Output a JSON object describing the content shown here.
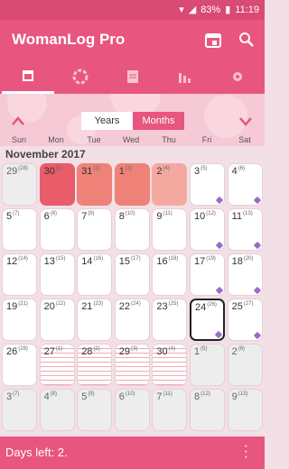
{
  "status": {
    "battery": "83%",
    "time": "11:19"
  },
  "app": {
    "title": "WomanLog Pro"
  },
  "view": {
    "years": "Years",
    "months": "Months"
  },
  "days_of_week": [
    "Sun",
    "Mon",
    "Tue",
    "Wed",
    "Thu",
    "Fri",
    "Sat"
  ],
  "month_title": "November 2017",
  "footer": {
    "days_left": "Days left: 2."
  },
  "calendar": [
    {
      "d": "29",
      "s": "(28)",
      "st": "gray"
    },
    {
      "d": "30",
      "s": "(1)",
      "st": "dark"
    },
    {
      "d": "31",
      "s": "(2)",
      "st": "mid"
    },
    {
      "d": "1",
      "s": "(3)",
      "st": "mid"
    },
    {
      "d": "2",
      "s": "(4)",
      "st": "light"
    },
    {
      "d": "3",
      "s": "(5)",
      "st": "white"
    },
    {
      "d": "4",
      "s": "(6)",
      "st": "white"
    },
    {
      "d": "5",
      "s": "(7)",
      "st": "white"
    },
    {
      "d": "6",
      "s": "(8)",
      "st": "white"
    },
    {
      "d": "7",
      "s": "(9)",
      "st": "white"
    },
    {
      "d": "8",
      "s": "(10)",
      "st": "white"
    },
    {
      "d": "9",
      "s": "(11)",
      "st": "white"
    },
    {
      "d": "10",
      "s": "(12)",
      "st": "white"
    },
    {
      "d": "11",
      "s": "(13)",
      "st": "white"
    },
    {
      "d": "12",
      "s": "(14)",
      "st": "white"
    },
    {
      "d": "13",
      "s": "(15)",
      "st": "white"
    },
    {
      "d": "14",
      "s": "(16)",
      "st": "white"
    },
    {
      "d": "15",
      "s": "(17)",
      "st": "white"
    },
    {
      "d": "16",
      "s": "(18)",
      "st": "white"
    },
    {
      "d": "17",
      "s": "(19)",
      "st": "white"
    },
    {
      "d": "18",
      "s": "(20)",
      "st": "white"
    },
    {
      "d": "19",
      "s": "(21)",
      "st": "white"
    },
    {
      "d": "20",
      "s": "(22)",
      "st": "white"
    },
    {
      "d": "21",
      "s": "(23)",
      "st": "white"
    },
    {
      "d": "22",
      "s": "(24)",
      "st": "white"
    },
    {
      "d": "23",
      "s": "(25)",
      "st": "white"
    },
    {
      "d": "24",
      "s": "(26)",
      "st": "today"
    },
    {
      "d": "25",
      "s": "(27)",
      "st": "white"
    },
    {
      "d": "26",
      "s": "(28)",
      "st": "white"
    },
    {
      "d": "27",
      "s": "(1)",
      "st": "striped"
    },
    {
      "d": "28",
      "s": "(2)",
      "st": "striped"
    },
    {
      "d": "29",
      "s": "(3)",
      "st": "striped"
    },
    {
      "d": "30",
      "s": "(4)",
      "st": "striped"
    },
    {
      "d": "1",
      "s": "(5)",
      "st": "gray"
    },
    {
      "d": "2",
      "s": "(6)",
      "st": "gray"
    },
    {
      "d": "3",
      "s": "(7)",
      "st": "gray"
    },
    {
      "d": "4",
      "s": "(8)",
      "st": "gray"
    },
    {
      "d": "5",
      "s": "(9)",
      "st": "gray"
    },
    {
      "d": "6",
      "s": "(10)",
      "st": "gray"
    },
    {
      "d": "7",
      "s": "(11)",
      "st": "gray"
    },
    {
      "d": "8",
      "s": "(12)",
      "st": "gray"
    },
    {
      "d": "9",
      "s": "(13)",
      "st": "gray"
    }
  ]
}
